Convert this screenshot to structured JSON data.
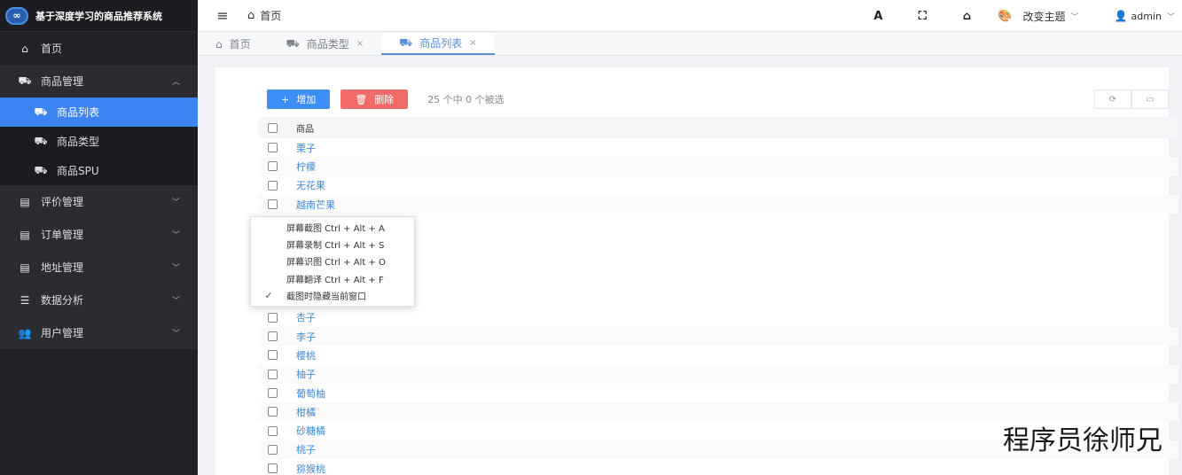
{
  "app": {
    "title": "基于深度学习的商品推荐系统",
    "logo_text": "∞"
  },
  "sidebar": {
    "items": [
      {
        "label": "首页",
        "icon": "home-icon"
      },
      {
        "label": "商品管理",
        "icon": "car-icon"
      },
      {
        "label": "评价管理",
        "icon": "table-icon"
      },
      {
        "label": "订单管理",
        "icon": "table-icon"
      },
      {
        "label": "地址管理",
        "icon": "table-icon"
      },
      {
        "label": "数据分析",
        "icon": "list-icon"
      },
      {
        "label": "用户管理",
        "icon": "users-icon"
      }
    ],
    "subitems": [
      {
        "label": "商品列表",
        "icon": "car-icon"
      },
      {
        "label": "商品类型",
        "icon": "car-icon"
      },
      {
        "label": "商品SPU",
        "icon": "car-icon"
      }
    ],
    "active_color": "#3c82f0"
  },
  "topbar": {
    "breadcrumb": "首页",
    "theme_label": "改变主题",
    "user": "admin",
    "font_button": "A"
  },
  "tabs": [
    {
      "label": "首页"
    },
    {
      "label": "商品类型",
      "close": "×"
    },
    {
      "label": "商品列表",
      "close": "×"
    }
  ],
  "toolbar": {
    "add_label": "增加",
    "delete_label": "删除",
    "selection_info": "25 个中 0 个被选",
    "add_color": "#3e8ef7",
    "delete_color": "#f26b6b"
  },
  "table": {
    "header": "商品",
    "rows_top": [
      "栗子",
      "柠檬",
      "无花果",
      "越南芒果"
    ],
    "rows_bottom": [
      "杏子",
      "李子",
      "樱桃",
      "柚子",
      "葡萄柚",
      "柑橘",
      "砂糖橘",
      "桃子",
      "猕猴桃"
    ],
    "link_color": "#3f8bd8"
  },
  "context_menu": {
    "items": [
      {
        "label": "屏幕截图 Ctrl + Alt + A",
        "checked": false
      },
      {
        "label": "屏幕录制 Ctrl + Alt + S",
        "checked": false
      },
      {
        "label": "屏幕识图 Ctrl + Alt + O",
        "checked": false
      },
      {
        "label": "屏幕翻译 Ctrl + Alt + F",
        "checked": false
      },
      {
        "label": "截图时隐藏当前窗口",
        "checked": true
      }
    ]
  },
  "watermark": "程序员徐师兄"
}
